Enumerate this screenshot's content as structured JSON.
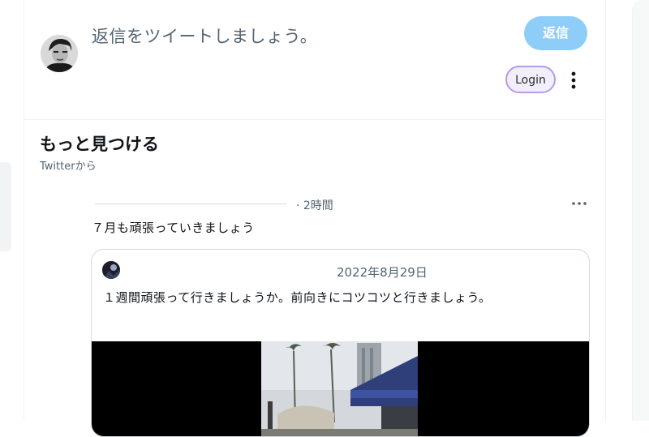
{
  "composer": {
    "placeholder": "返信をツイートしましょう。",
    "reply_label": "返信",
    "login_label": "Login",
    "avatar_icon": "profile-avatar",
    "more_icon": "more-vertical-icon"
  },
  "discover": {
    "title": "もっと見つける",
    "subtitle": "Twitterから"
  },
  "tweet": {
    "time": "· 2時間",
    "text": "７月も頑張っていきましょう",
    "more_icon": "more-horizontal-icon",
    "quote": {
      "date": "2022年8月29日",
      "text": "１週間頑張って行きましょうか。前向きにコツコツと行きましょう。"
    }
  },
  "colors": {
    "reply_button": "#8ecdf7",
    "login_border": "#b69ae8",
    "muted_text": "#536471",
    "border": "#cfd9de"
  }
}
